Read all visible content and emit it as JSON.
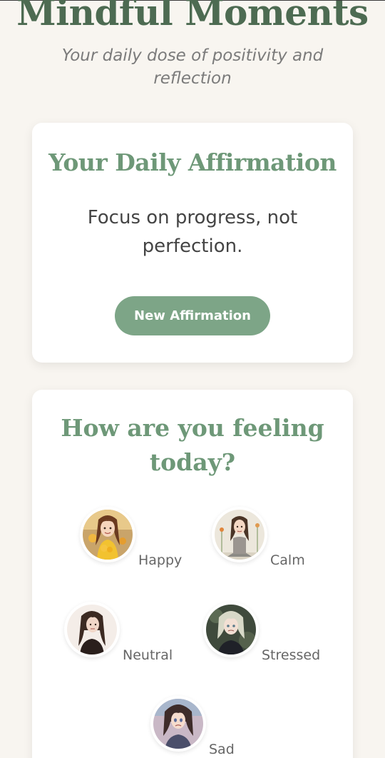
{
  "header": {
    "title": "Mindful Moments",
    "tagline": "Your daily dose of positivity and reflection"
  },
  "affirmation": {
    "heading": "Your Daily Affirmation",
    "text": "Focus on progress, not perfection.",
    "button_label": "New Affirmation"
  },
  "mood": {
    "heading": "How are you feeling today?",
    "options": [
      {
        "label": "Happy",
        "icon": "happy-avatar"
      },
      {
        "label": "Calm",
        "icon": "calm-avatar"
      },
      {
        "label": "Neutral",
        "icon": "neutral-avatar"
      },
      {
        "label": "Stressed",
        "icon": "stressed-avatar"
      },
      {
        "label": "Sad",
        "icon": "sad-avatar"
      }
    ]
  },
  "colors": {
    "background": "#f8f5f0",
    "title": "#4d6b52",
    "accent": "#6e9878",
    "button": "#7da587"
  }
}
